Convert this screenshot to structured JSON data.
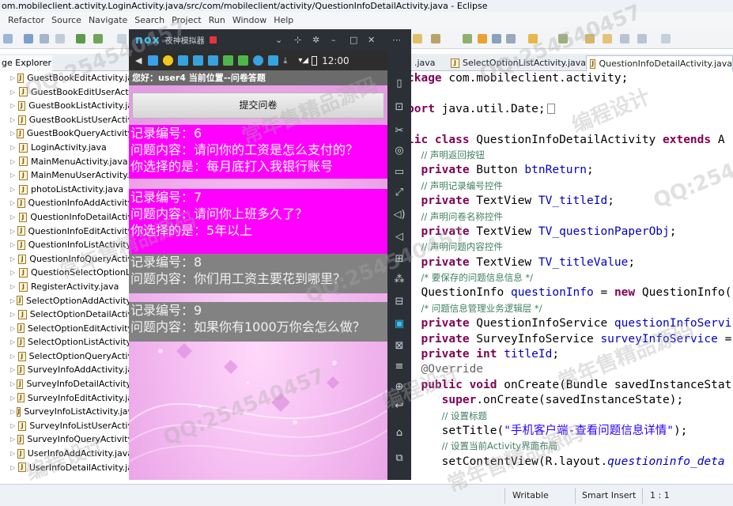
{
  "window": {
    "title": "om.mobileclient.activity.LoginActivity.java/src/com/mobileclient/activity/QuestionInfoDetailActivity.java - Eclipse"
  },
  "menu": [
    "Refactor",
    "Source",
    "Navigate",
    "Search",
    "Project",
    "Run",
    "Window",
    "Help"
  ],
  "package_explorer": {
    "tab_label": "ge Explorer",
    "close": "⊠",
    "files": [
      "GuestBookEditActivity.ja",
      "GuestBookEditUserActi",
      "GuestBookListActivity.ja",
      "GuestBookListUserActiv",
      "GuestBookQueryActivity",
      "LoginActivity.java",
      "MainMenuActivity.java",
      "MainMenuUserActivity.j",
      "photoListActivity.java",
      "QuestionInfoAddActivity",
      "QuestionInfoDetailActiv",
      "QuestionInfoEditActivity",
      "QuestionInfoListActivity.",
      "QuestionInfoQueryActiv",
      "QuestionSelectOptionLi",
      "RegisterActivity.java",
      "SelectOptionAddActivity.",
      "SelectOptionDetailActiv",
      "SelectOptionEditActivity",
      "SelectOptionListActivity.",
      "SelectOptionQueryActiv",
      "SurveyInfoAddActivity.ja",
      "SurveyInfoDetailActivity.",
      "SurveyInfoEditActivity.ja",
      "SurveyInfoListActivity.jav",
      "SurveyInfoListUserActiv",
      "SurveyInfoQueryActivity",
      "UserInfoAddActivity.java",
      "UserInfoDetailActivity.ja"
    ]
  },
  "editor_tabs": [
    {
      "label": ".java",
      "active": false
    },
    {
      "label": "SelectOptionListActivity.java",
      "active": false
    },
    {
      "label": "QuestionInfoDetailActivity.java",
      "active": true
    }
  ],
  "editor": {
    "lines": [
      [
        {
          "c": "kw",
          "t": "ckage"
        },
        {
          "c": "",
          "t": " com.mobileclient.activity;"
        }
      ],
      [
        {
          "c": "",
          "t": ""
        }
      ],
      [
        {
          "c": "kw",
          "t": "port"
        },
        {
          "c": "",
          "t": " java.util.Date;"
        },
        {
          "c": "box",
          "t": ""
        }
      ],
      [
        {
          "c": "",
          "t": ""
        }
      ],
      [
        {
          "c": "kw",
          "t": "lic class"
        },
        {
          "c": "",
          "t": " QuestionInfoDetailActivity "
        },
        {
          "c": "kw",
          "t": "extends"
        },
        {
          "c": "",
          "t": " A"
        }
      ],
      [
        {
          "c": "ind",
          "t": ""
        },
        {
          "c": "cm",
          "t": "// 声明返回按钮"
        }
      ],
      [
        {
          "c": "ind",
          "t": ""
        },
        {
          "c": "kw",
          "t": "private"
        },
        {
          "c": "",
          "t": " Button "
        },
        {
          "c": "fd",
          "t": "btnReturn"
        },
        {
          "c": "",
          "t": ";"
        }
      ],
      [
        {
          "c": "ind",
          "t": ""
        },
        {
          "c": "cm",
          "t": "// 声明记录编号控件"
        }
      ],
      [
        {
          "c": "ind",
          "t": ""
        },
        {
          "c": "kw",
          "t": "private"
        },
        {
          "c": "",
          "t": " TextView "
        },
        {
          "c": "fd",
          "t": "TV_titleId"
        },
        {
          "c": "",
          "t": ";"
        }
      ],
      [
        {
          "c": "ind",
          "t": ""
        },
        {
          "c": "cm",
          "t": "// 声明问卷名称控件"
        }
      ],
      [
        {
          "c": "ind",
          "t": ""
        },
        {
          "c": "kw",
          "t": "private"
        },
        {
          "c": "",
          "t": " TextView "
        },
        {
          "c": "fd",
          "t": "TV_questionPaperObj"
        },
        {
          "c": "",
          "t": ";"
        }
      ],
      [
        {
          "c": "ind",
          "t": ""
        },
        {
          "c": "cm",
          "t": "// 声明问题内容控件"
        }
      ],
      [
        {
          "c": "ind",
          "t": ""
        },
        {
          "c": "kw",
          "t": "private"
        },
        {
          "c": "",
          "t": " TextView "
        },
        {
          "c": "fd",
          "t": "TV_titleValue"
        },
        {
          "c": "",
          "t": ";"
        }
      ],
      [
        {
          "c": "ind",
          "t": ""
        },
        {
          "c": "cm",
          "t": "/* 要保存的问题信息信息 */"
        }
      ],
      [
        {
          "c": "ind",
          "t": ""
        },
        {
          "c": "",
          "t": "QuestionInfo "
        },
        {
          "c": "fd",
          "t": "questionInfo"
        },
        {
          "c": "",
          "t": " = "
        },
        {
          "c": "kw",
          "t": "new"
        },
        {
          "c": "",
          "t": " QuestionInfo("
        }
      ],
      [
        {
          "c": "ind",
          "t": ""
        },
        {
          "c": "cm",
          "t": "/* 问题信息管理业务逻辑层 */"
        }
      ],
      [
        {
          "c": "ind",
          "t": ""
        },
        {
          "c": "kw",
          "t": "private"
        },
        {
          "c": "",
          "t": " QuestionInfoService "
        },
        {
          "c": "fd",
          "t": "questionInfoServi"
        }
      ],
      [
        {
          "c": "ind",
          "t": ""
        },
        {
          "c": "kw",
          "t": "private"
        },
        {
          "c": "",
          "t": " SurveyInfoService "
        },
        {
          "c": "fd",
          "t": "surveyInfoService"
        },
        {
          "c": "",
          "t": " ="
        }
      ],
      [
        {
          "c": "ind",
          "t": ""
        },
        {
          "c": "kw",
          "t": "private int"
        },
        {
          "c": "",
          "t": " "
        },
        {
          "c": "fd",
          "t": "titleId"
        },
        {
          "c": "",
          "t": ";"
        }
      ],
      [
        {
          "c": "ind",
          "t": ""
        },
        {
          "c": "an",
          "t": "@Override"
        }
      ],
      [
        {
          "c": "ind",
          "t": ""
        },
        {
          "c": "kw",
          "t": "public void"
        },
        {
          "c": "",
          "t": " onCreate(Bundle savedInstanceStat"
        }
      ],
      [
        {
          "c": "ind2",
          "t": ""
        },
        {
          "c": "kw",
          "t": "super"
        },
        {
          "c": "",
          "t": ".onCreate(savedInstanceState);"
        }
      ],
      [
        {
          "c": "ind2",
          "t": ""
        },
        {
          "c": "cm",
          "t": "// 设置标题"
        }
      ],
      [
        {
          "c": "ind2",
          "t": ""
        },
        {
          "c": "",
          "t": "setTitle("
        },
        {
          "c": "st",
          "t": "\"手机客户端-查看问题信息详情\""
        },
        {
          "c": "",
          "t": ");"
        }
      ],
      [
        {
          "c": "ind2",
          "t": ""
        },
        {
          "c": "cm",
          "t": "// 设置当前Activity界面布局"
        }
      ],
      [
        {
          "c": "ind2",
          "t": ""
        },
        {
          "c": "",
          "t": "setContentView(R.layout."
        },
        {
          "c": "it",
          "t": "questioninfo_deta"
        }
      ]
    ]
  },
  "status": {
    "writable": "Writable",
    "insert": "Smart Insert",
    "position": "1 : 1"
  },
  "emulator": {
    "brand": "nox",
    "name": "夜神模拟器",
    "clock": "12:00",
    "greeting": "您好：user4  当前位置--问卷答题",
    "submit": "提交问卷",
    "records": [
      {
        "id_line": "记录编号：6",
        "question_line": "问题内容：请问你的工资是怎么支付的？",
        "answer_line": "你选择的是：每月底打入我银行账号",
        "selected": true
      },
      {
        "id_line": "记录编号：7",
        "question_line": "问题内容：请问你上班多久了？",
        "answer_line": "你选择的是：5年以上",
        "selected": true
      },
      {
        "id_line": "记录编号：8",
        "question_line": "问题内容：你们用工资主要花到哪里？",
        "answer_line": "",
        "selected": false
      },
      {
        "id_line": "记录编号：9",
        "question_line": "问题内容：如果你有1000万你会怎么做？",
        "answer_line": "",
        "selected": false
      }
    ]
  },
  "watermark": [
    "QQ:254540457",
    "常年售精品源码",
    "编程设计"
  ],
  "colors": {
    "selected_record": "#ff00ff",
    "unselected_record": "#828282",
    "phone_bg": "#f3c8f1",
    "keyword": "#7f0055",
    "comment": "#3f7f5f",
    "field": "#0000c0",
    "string": "#2a00ff"
  }
}
